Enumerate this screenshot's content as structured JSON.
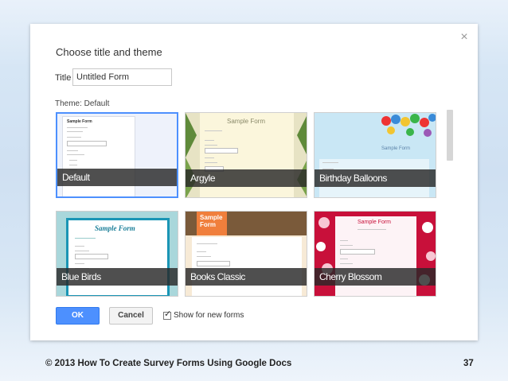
{
  "dialog": {
    "heading": "Choose title and theme",
    "close_glyph": "×",
    "title_label": "Title",
    "title_value": "Untitled Form",
    "theme_label": "Theme: Default"
  },
  "themes": [
    {
      "label": "Default",
      "preview_title": "Sample Form",
      "selected": true
    },
    {
      "label": "Argyle",
      "preview_title": "Sample Form",
      "selected": false
    },
    {
      "label": "Birthday Balloons",
      "preview_title": "Sample Form",
      "selected": false
    },
    {
      "label": "Blue Birds",
      "preview_title": "Sample Form",
      "selected": false
    },
    {
      "label": "Books Classic",
      "preview_title": "Sample Form",
      "selected": false
    },
    {
      "label": "Cherry Blossom",
      "preview_title": "Sample Form",
      "selected": false
    }
  ],
  "buttons": {
    "ok": "OK",
    "cancel": "Cancel"
  },
  "checkbox": {
    "label": "Show for new forms",
    "checked": true
  },
  "footer": {
    "left": "© 2013 How To Create Survey Forms Using Google Docs",
    "right": "37"
  },
  "colors": {
    "accent": "#4d90fe",
    "selected_border": "#4d90fe"
  },
  "icons": {
    "close": "close-icon",
    "check": "checkmark-icon"
  }
}
